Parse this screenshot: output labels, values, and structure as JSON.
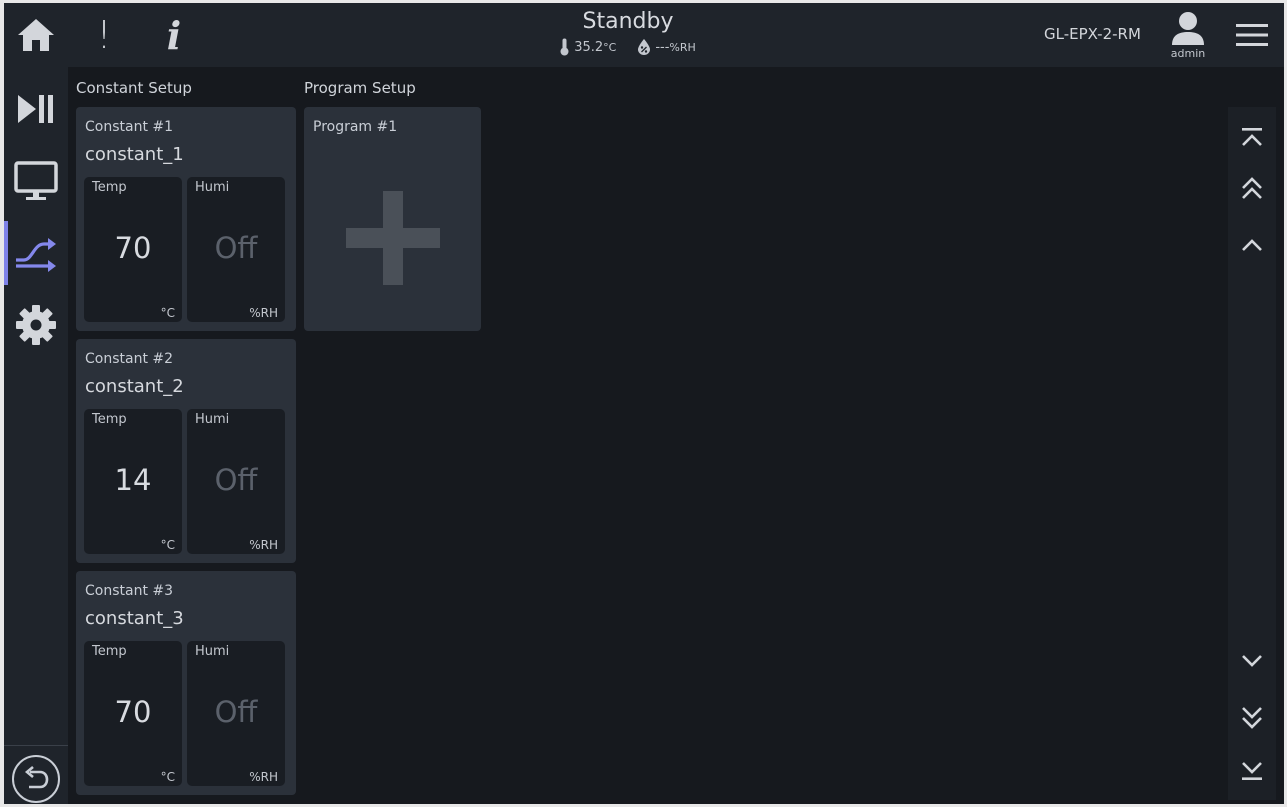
{
  "header": {
    "status": "Standby",
    "temperature": "35.2",
    "temperature_unit": "°C",
    "humidity": "---",
    "humidity_unit": "%RH",
    "device_name": "GL-EPX-2-RM",
    "user": "admin",
    "alarm_glyph": "!",
    "info_glyph": "i"
  },
  "icons": {
    "home": "home-icon",
    "alarm": "exclamation-icon",
    "info": "info-icon",
    "thermometer": "thermometer-icon",
    "humidity": "droplet-icon",
    "user": "user-icon",
    "menu": "hamburger-icon",
    "run": "play-pause-icon",
    "monitor": "monitor-icon",
    "setup": "shuffle-icon",
    "settings": "gear-icon",
    "back": "back-arrow-icon",
    "scroll_top": "scroll-top-icon",
    "page_up": "double-chevron-up-icon",
    "line_up": "chevron-up-icon",
    "line_down": "chevron-down-icon",
    "page_down": "double-chevron-down-icon",
    "scroll_bottom": "scroll-bottom-icon",
    "add": "plus-icon"
  },
  "colors": {
    "accent": "#7f83e8",
    "background": "#16191e",
    "panel": "#1f242b",
    "card": "#2b313a",
    "value_box": "#191d23",
    "text": "#d3d6db",
    "muted": "#5b616b"
  },
  "sections": {
    "constant": "Constant Setup",
    "program": "Program Setup"
  },
  "constants": [
    {
      "label": "Constant #1",
      "name": "constant_1",
      "temp_label": "Temp",
      "temp_value": "70",
      "temp_unit": "°C",
      "humi_label": "Humi",
      "humi_value": "Off",
      "humi_unit": "%RH"
    },
    {
      "label": "Constant #2",
      "name": "constant_2",
      "temp_label": "Temp",
      "temp_value": "14",
      "temp_unit": "°C",
      "humi_label": "Humi",
      "humi_value": "Off",
      "humi_unit": "%RH"
    },
    {
      "label": "Constant #3",
      "name": "constant_3",
      "temp_label": "Temp",
      "temp_value": "70",
      "temp_unit": "°C",
      "humi_label": "Humi",
      "humi_value": "Off",
      "humi_unit": "%RH"
    }
  ],
  "programs": [
    {
      "label": "Program #1"
    }
  ]
}
